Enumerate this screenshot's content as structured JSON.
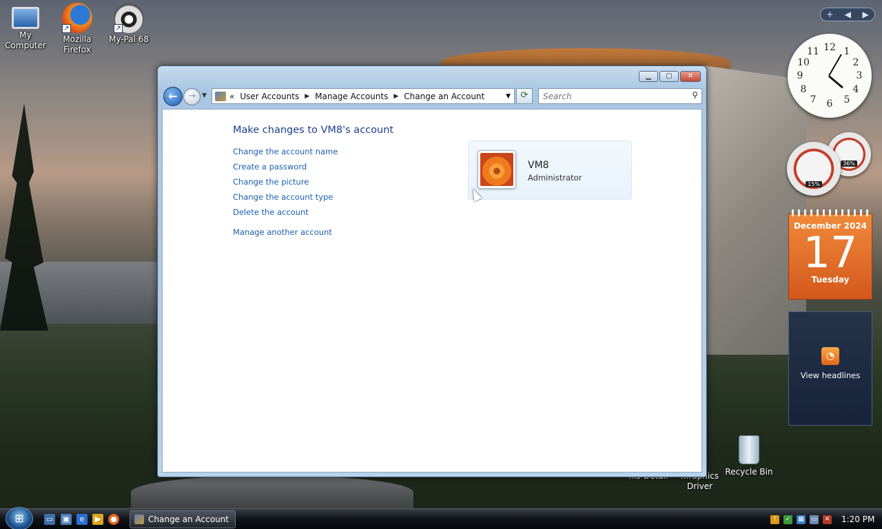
{
  "desktop": {
    "icons": [
      {
        "label": "My\nComputer",
        "line1": "My",
        "line2": "Computer"
      },
      {
        "label": "Mozilla Firefox",
        "line1": "Mozilla",
        "line2": "Firefox"
      },
      {
        "label": "My-Pal 68",
        "line1": "My-Pal 68",
        "line2": ""
      }
    ],
    "recycle_bin": "Recycle Bin",
    "partial_icon_1": "...s-Detail",
    "partial_icon_2_line1": "...raphics",
    "partial_icon_2_line2": "Driver"
  },
  "window": {
    "breadcrumb": [
      "User Accounts",
      "Manage Accounts",
      "Change an Account"
    ],
    "breadcrumb_prefix": "«",
    "search_placeholder": "Search",
    "heading": "Make changes to VM8's account",
    "links": [
      "Change the account name",
      "Create a password",
      "Change the picture",
      "Change the account type",
      "Delete the account"
    ],
    "manage_other": "Manage another account",
    "account": {
      "name": "VM8",
      "type": "Administrator"
    }
  },
  "gadgets": {
    "clock_numbers": [
      "12",
      "1",
      "2",
      "3",
      "4",
      "5",
      "6",
      "7",
      "8",
      "9",
      "10",
      "11"
    ],
    "cpu_percent": "15%",
    "mem_percent": "36%",
    "calendar": {
      "month": "December 2024",
      "day": "17",
      "weekday": "Tuesday"
    },
    "feed_label": "View headlines"
  },
  "taskbar": {
    "active_task": "Change an Account",
    "time": "1:20 PM"
  }
}
